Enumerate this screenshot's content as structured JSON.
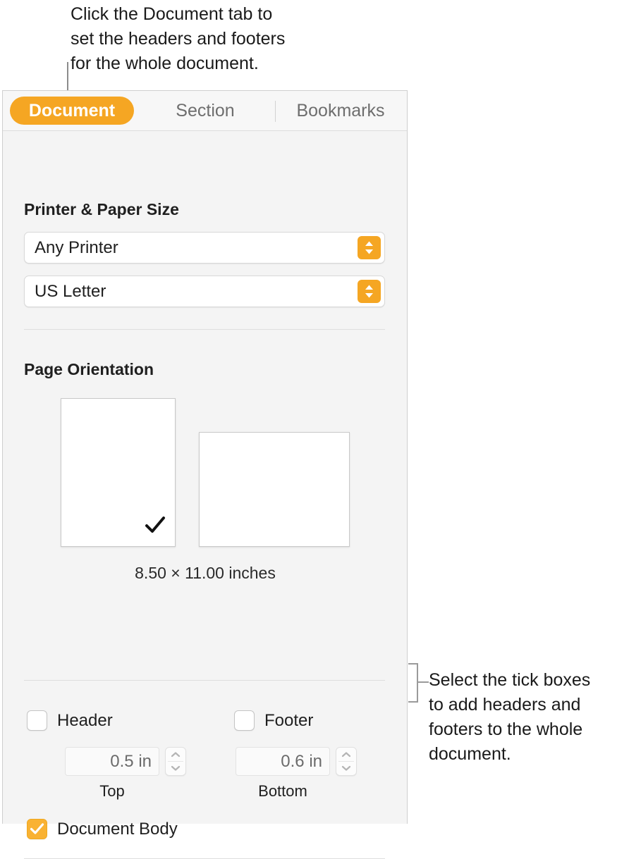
{
  "callouts": {
    "top": "Click the Document tab to\nset the headers and footers\nfor the whole document.",
    "right": "Select the tick boxes\nto add headers and\nfooters to the whole\ndocument."
  },
  "inspector": {
    "tabs": [
      {
        "label": "Document",
        "selected": true
      },
      {
        "label": "Section",
        "selected": false
      },
      {
        "label": "Bookmarks",
        "selected": false
      }
    ],
    "printer_paper_size": {
      "title": "Printer & Paper Size",
      "printer": {
        "value": "Any Printer",
        "chevron_icon": "chevron-up-down-icon"
      },
      "paper_size": {
        "value": "US Letter",
        "chevron_icon": "chevron-up-down-icon"
      }
    },
    "page_orientation": {
      "title": "Page Orientation",
      "portrait": {
        "selected": true,
        "check_icon": "checkmark-icon"
      },
      "landscape": {
        "selected": false
      },
      "dimensions": "8.50 × 11.00 inches"
    },
    "header_footer": {
      "header": {
        "label": "Header",
        "checked": false
      },
      "footer": {
        "label": "Footer",
        "checked": false
      },
      "top": {
        "value": "0.5 in",
        "caption": "Top",
        "stepper_icon": "stepper-up-down-icon"
      },
      "bottom": {
        "value": "0.6 in",
        "caption": "Bottom",
        "stepper_icon": "stepper-up-down-icon"
      },
      "document_body": {
        "label": "Document Body",
        "checked": true,
        "check_icon": "checkmark-icon"
      }
    }
  },
  "colors": {
    "accent_orange": "#f5a623",
    "checkbox_orange": "#f9b233",
    "panel_background": "#f4f4f4",
    "tabbar_background": "#f7f7f7"
  }
}
